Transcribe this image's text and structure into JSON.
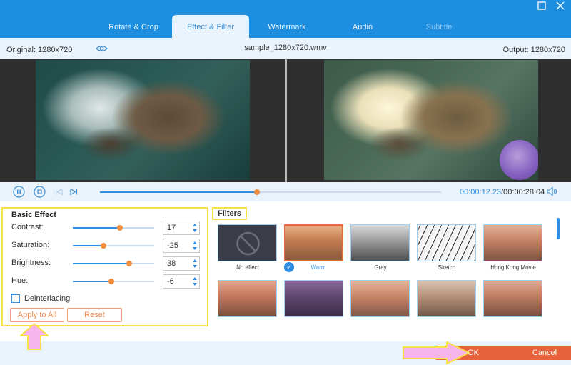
{
  "window": {
    "maximize_icon": "maximize-icon",
    "close_icon": "close-icon"
  },
  "tabs": [
    {
      "label": "Rotate & Crop",
      "state": "normal"
    },
    {
      "label": "Effect & Filter",
      "state": "active"
    },
    {
      "label": "Watermark",
      "state": "normal"
    },
    {
      "label": "Audio",
      "state": "normal"
    },
    {
      "label": "Subtitle",
      "state": "disabled"
    }
  ],
  "info": {
    "original": "Original: 1280x720",
    "filename": "sample_1280x720.wmv",
    "output": "Output: 1280x720"
  },
  "playback": {
    "current_time": "00:00:12.23",
    "total_time": "/00:00:28.04",
    "progress": 0.46
  },
  "basic_effect": {
    "title": "Basic Effect",
    "params": [
      {
        "label": "Contrast:",
        "value": "17",
        "level": 0.58
      },
      {
        "label": "Saturation:",
        "value": "-25",
        "level": 0.38
      },
      {
        "label": "Brightness:",
        "value": "38",
        "level": 0.69
      },
      {
        "label": "Hue:",
        "value": "-6",
        "level": 0.47
      }
    ],
    "deinterlacing_label": "Deinterlacing",
    "deinterlacing_checked": false,
    "apply_all_label": "Apply to All",
    "reset_label": "Reset"
  },
  "filters": {
    "title": "Filters",
    "items": [
      {
        "name": "No effect",
        "selected": false
      },
      {
        "name": "Warm",
        "selected": true
      },
      {
        "name": "Gray",
        "selected": false
      },
      {
        "name": "Sketch",
        "selected": false
      },
      {
        "name": "Hong Kong Movie",
        "selected": false
      }
    ]
  },
  "footer": {
    "ok_label": "OK",
    "cancel_label": "Cancel"
  },
  "colors": {
    "accent": "#2f8de4",
    "primary_button": "#e8623c",
    "highlight": "#f6e24a",
    "callout": "#f6b3ec"
  }
}
